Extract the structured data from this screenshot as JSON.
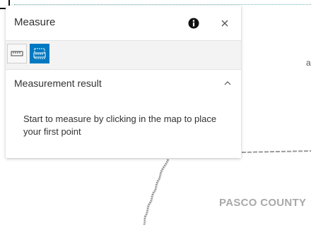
{
  "map": {
    "county_label": "PASCO COUNTY",
    "edge_glyph": "a"
  },
  "widget": {
    "title": "Measure",
    "info_icon": "info-icon",
    "close_icon": "close-icon",
    "tools": [
      {
        "name": "distance",
        "icon": "ruler-icon",
        "active": false
      },
      {
        "name": "area",
        "icon": "area-ruler-icon",
        "active": true
      }
    ],
    "result_section": {
      "title": "Measurement result",
      "expanded": true,
      "hint": "Start to measure by clicking in the map to place your first point"
    }
  },
  "colors": {
    "accent": "#0079c1",
    "map_label": "#a9a9a9",
    "text": "#323232"
  }
}
